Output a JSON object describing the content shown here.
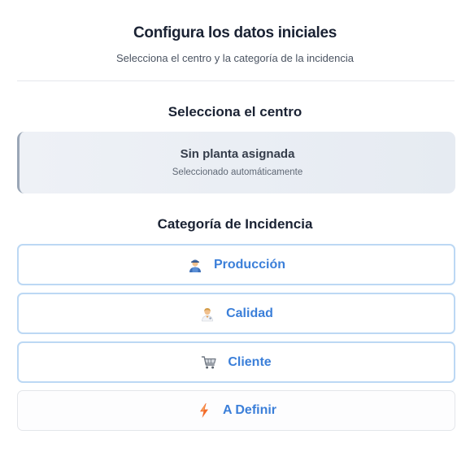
{
  "header": {
    "title": "Configura los datos iniciales",
    "subtitle": "Selecciona el centro y la categoría de la incidencia"
  },
  "center_section": {
    "title": "Selecciona el centro",
    "selected": {
      "name": "Sin planta asignada",
      "note": "Seleccionado automáticamente"
    }
  },
  "category_section": {
    "title": "Categoría de Incidencia",
    "options": [
      {
        "label": "Producción",
        "icon": "factory-worker-icon"
      },
      {
        "label": "Calidad",
        "icon": "inspector-icon"
      },
      {
        "label": "Cliente",
        "icon": "shopping-cart-icon"
      },
      {
        "label": "A Definir",
        "icon": "lightning-bolt-icon"
      }
    ]
  },
  "colors": {
    "title_text": "#1a2233",
    "accent_blue": "#3b7fd9",
    "button_border": "#bcd8f4",
    "selected_card_bg": "#e9edf3",
    "selected_card_border": "#9aa6b6",
    "bolt_orange": "#f26b2a"
  }
}
